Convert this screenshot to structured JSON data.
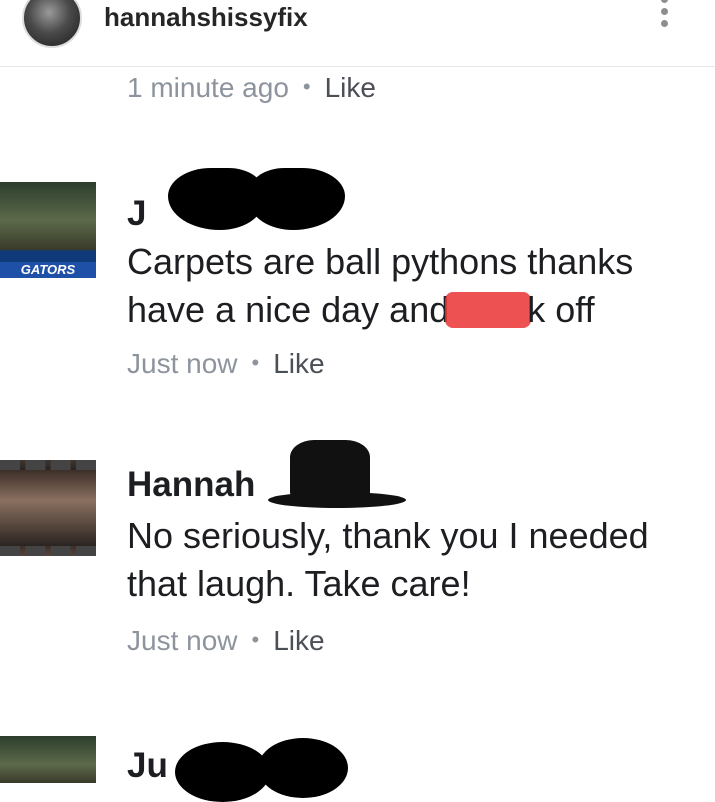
{
  "header": {
    "username": "hannahshissyfix",
    "icons": {
      "avatar": "profile-avatar",
      "more": "more-vertical-icon"
    }
  },
  "top_meta": {
    "time": "1 minute ago",
    "separator": "•",
    "like": "Like"
  },
  "comments": [
    {
      "author": "J",
      "text_line1": "Carpets are ball pythons thanks",
      "text_line2": "have a nice day and",
      "text_line2_end": "k off",
      "time": "Just now",
      "separator": "•",
      "like": "Like",
      "avatar_badge": "GATORS"
    },
    {
      "author": "Hannah",
      "text_line1": "No seriously, thank you I needed",
      "text_line2": "that laugh. Take care!",
      "time": "Just now",
      "separator": "•",
      "like": "Like"
    },
    {
      "author": "Ju"
    }
  ],
  "colors": {
    "meta_gray": "#8d949e",
    "redaction_red": "#eb3232",
    "text": "#1c1e21"
  }
}
